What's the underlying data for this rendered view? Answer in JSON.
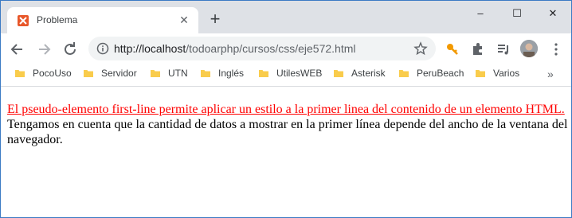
{
  "tab": {
    "title": "Problema",
    "close_icon": "close-icon"
  },
  "window_controls": {
    "minimize": "–",
    "maximize": "☐",
    "close": "✕"
  },
  "address_bar": {
    "host": "http://localhost",
    "path": "/todoarphp/cursos/css/eje572.html"
  },
  "bookmarks": {
    "items": [
      {
        "label": "PocoUso"
      },
      {
        "label": "Servidor"
      },
      {
        "label": "UTN"
      },
      {
        "label": "Inglés"
      },
      {
        "label": "UtilesWEB"
      },
      {
        "label": "Asterisk"
      },
      {
        "label": "PeruBeach"
      },
      {
        "label": "Varios"
      }
    ],
    "more": "»"
  },
  "content": {
    "first_line": "El pseudo-elemento first-line permite aplicar un estilo a la primer linea del contenido de un elemento HTML.",
    "rest": "Tengamos en cuenta que la cantidad de datos a mostrar en la primer línea depende del ancho de la ventana del navegador."
  },
  "colors": {
    "accent_first_line": "#ff0000",
    "tabstrip": "#dee1e6",
    "window_border": "#3c7bc4"
  }
}
